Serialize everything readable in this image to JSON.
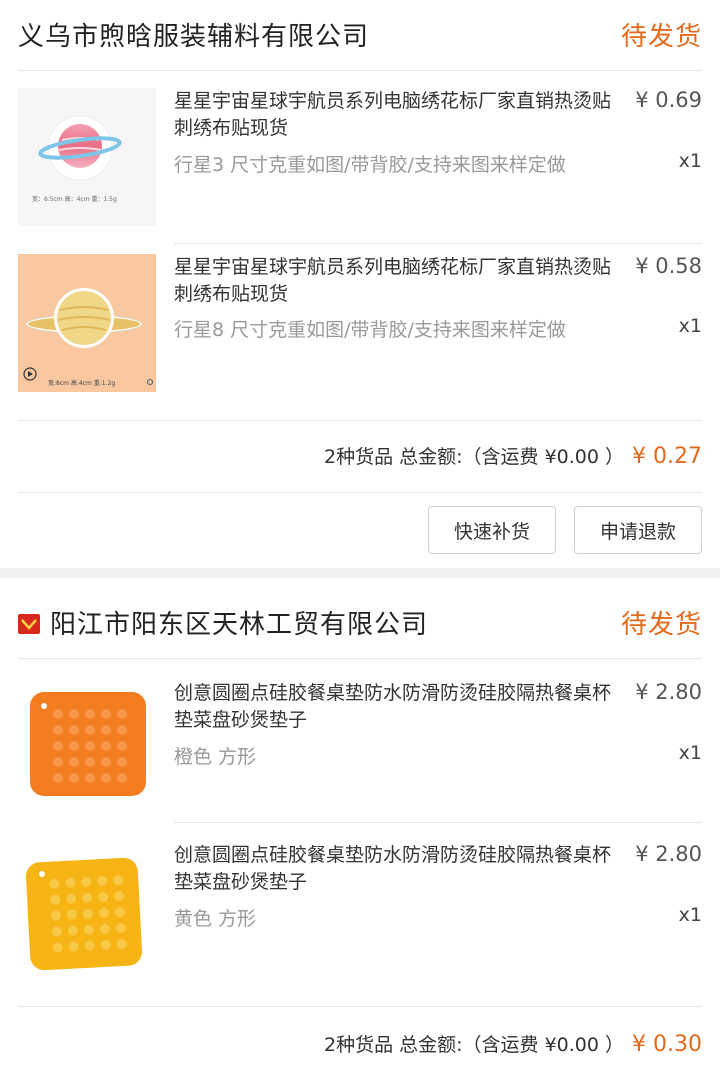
{
  "orders": [
    {
      "shop_name": "义乌市煦晗服装辅料有限公司",
      "status": "待发货",
      "items": [
        {
          "title": "星星宇宙星球宇航员系列电脑绣花标厂家直销热烫贴刺绣布贴现货",
          "sku": "行星3 尺寸克重如图/带背胶/支持来图来样定做",
          "price": "¥ 0.69",
          "qty": "x1",
          "image_caption": "宽：6.5cm 高：4cm 重：1.5g"
        },
        {
          "title": "星星宇宙星球宇航员系列电脑绣花标厂家直销热烫贴刺绣布贴现货",
          "sku": "行星8 尺寸克重如图/带背胶/支持来图来样定做",
          "price": "¥ 0.58",
          "qty": "x1",
          "image_caption": "宽:8cm  高:4cm  重:1.2g"
        }
      ],
      "summary": {
        "text": "2种货品 总金额:（含运费 ¥0.00 ）",
        "total": "¥ 0.27"
      },
      "buttons": [
        "快速补货",
        "申请退款"
      ]
    },
    {
      "shop_name": "阳江市阳东区天林工贸有限公司",
      "status": "待发货",
      "items": [
        {
          "title": "创意圆圈点硅胶餐桌垫防水防滑防烫硅胶隔热餐桌杯垫菜盘砂煲垫子",
          "sku": "橙色 方形",
          "price": "¥ 2.80",
          "qty": "x1",
          "color": "#f57d21"
        },
        {
          "title": "创意圆圈点硅胶餐桌垫防水防滑防烫硅胶隔热餐桌杯垫菜盘砂煲垫子",
          "sku": "黄色 方形",
          "price": "¥ 2.80",
          "qty": "x1",
          "color": "#f7b515"
        }
      ],
      "summary": {
        "text": "2种货品 总金额:（含运费 ¥0.00 ）",
        "total": "¥ 0.30"
      }
    }
  ],
  "colors": {
    "accent": "#e36a1c",
    "shop_icon": "#d9281c"
  }
}
